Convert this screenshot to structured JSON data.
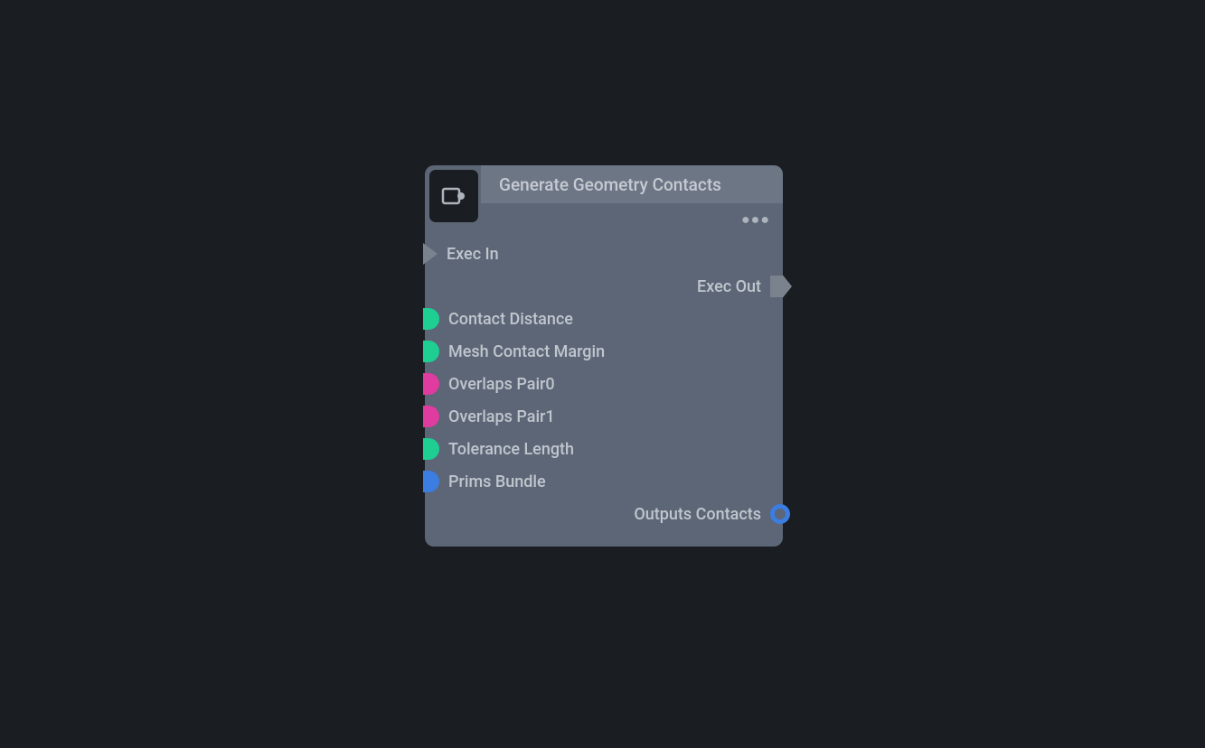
{
  "node": {
    "title": "Generate Geometry Contacts",
    "inputs": {
      "exec_in": "Exec In",
      "contact_distance": "Contact Distance",
      "mesh_contact_margin": "Mesh Contact Margin",
      "overlaps_pair0": "Overlaps Pair0",
      "overlaps_pair1": "Overlaps Pair1",
      "tolerance_length": "Tolerance Length",
      "prims_bundle": "Prims Bundle"
    },
    "outputs": {
      "exec_out": "Exec Out",
      "outputs_contacts": "Outputs Contacts"
    }
  }
}
